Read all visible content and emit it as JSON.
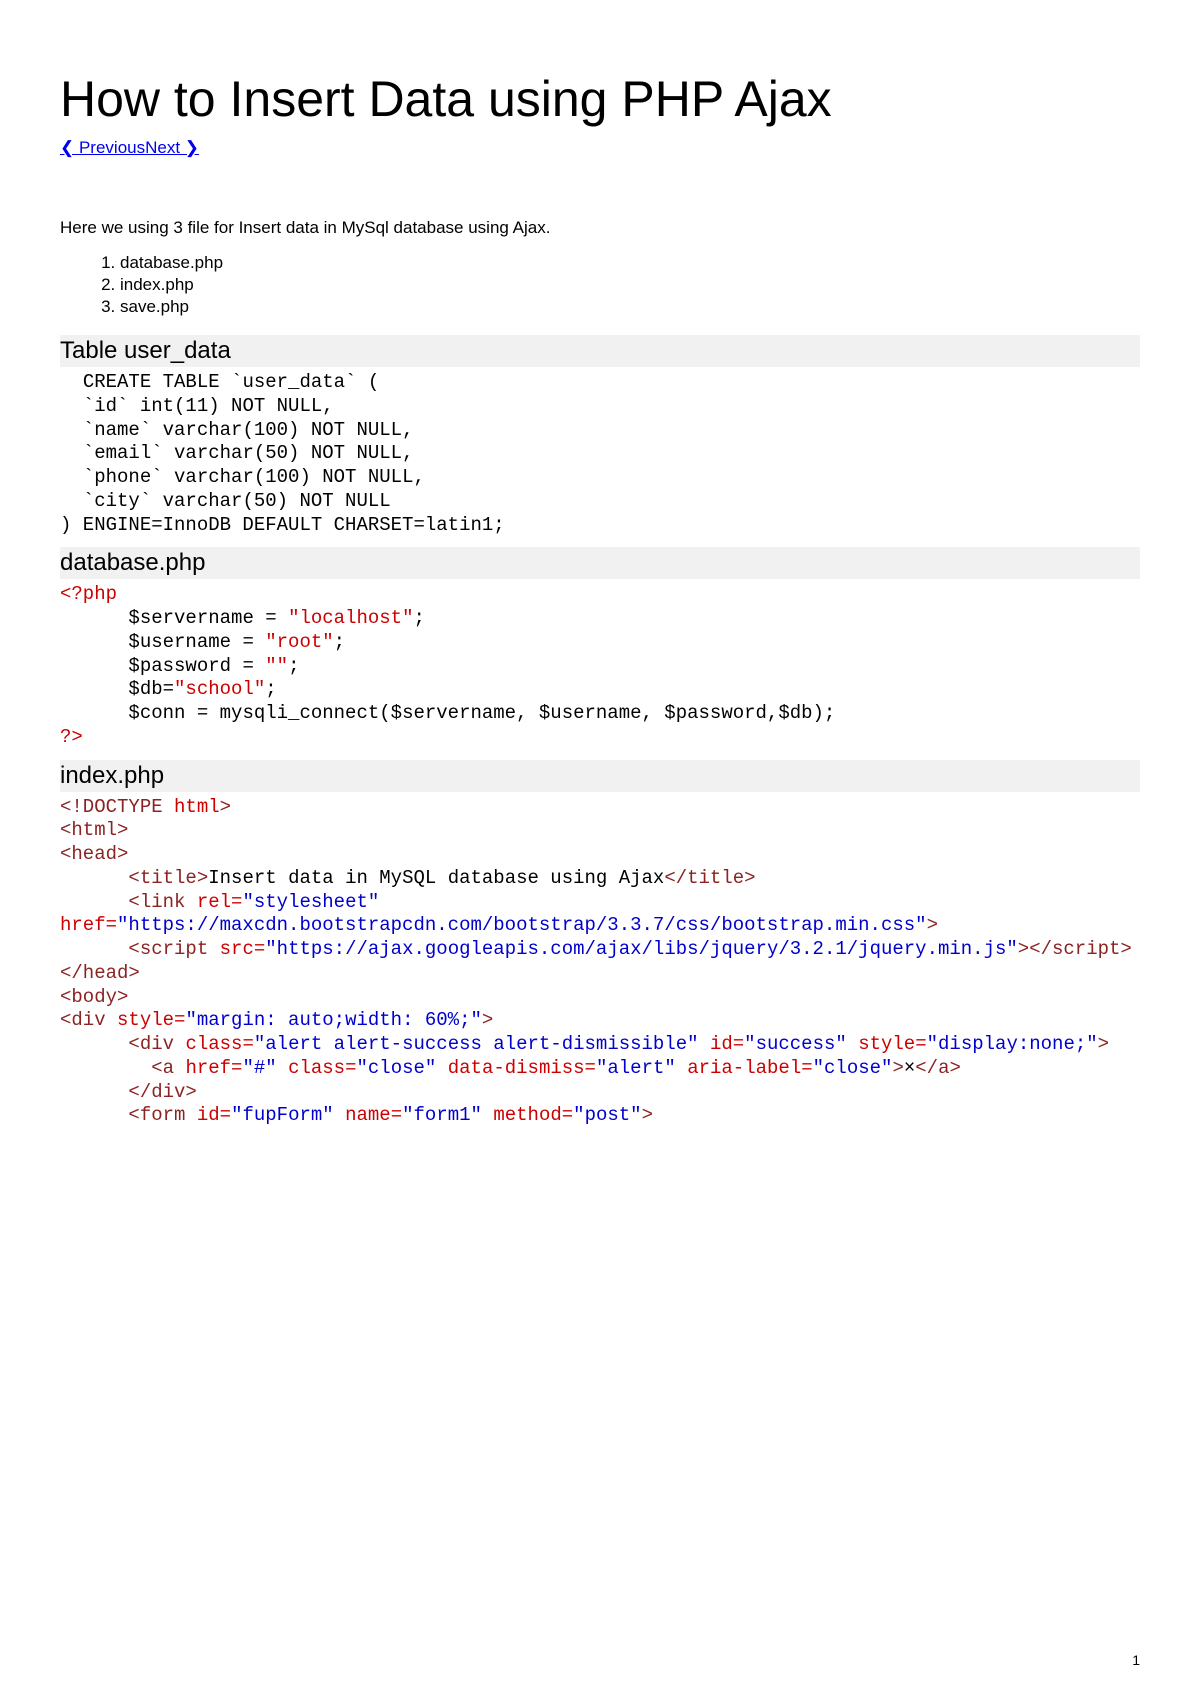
{
  "title": "How to Insert Data using PHP Ajax",
  "nav": {
    "previous": "❮ Previous",
    "next": "Next ❯"
  },
  "intro": "Here we using 3 file for Insert data in MySql database using Ajax.",
  "files": [
    "database.php",
    "index.php",
    "save.php"
  ],
  "sections": {
    "s1": {
      "heading": "Table user_data",
      "code": "  CREATE TABLE `user_data` (\n  `id` int(11) NOT NULL,\n  `name` varchar(100) NOT NULL,\n  `email` varchar(50) NOT NULL,\n  `phone` varchar(100) NOT NULL,\n  `city` varchar(50) NOT NULL\n) ENGINE=InnoDB DEFAULT CHARSET=latin1;"
    },
    "s2": {
      "heading": "database.php",
      "code_html": "<span class=\"red\">&lt;?php</span>\n      $servername = <span class=\"red\">\"localhost\"</span>;\n      $username = <span class=\"red\">\"root\"</span>;\n      $password = <span class=\"red\">\"\"</span>;\n      $db=<span class=\"red\">\"school\"</span>;\n      $conn = mysqli_connect($servername, $username, $password,$db);\n<span class=\"red\">?&gt;</span>"
    },
    "s3": {
      "heading": "index.php",
      "code_html": "<span class=\"brown\">&lt;!DOCTYPE</span> <span class=\"red\">html</span><span class=\"brown\">&gt;</span>\n<span class=\"brown\">&lt;html&gt;</span>\n<span class=\"brown\">&lt;head&gt;</span>\n      <span class=\"brown\">&lt;title&gt;</span>Insert data in MySQL database using Ajax<span class=\"brown\">&lt;/title&gt;</span>\n      <span class=\"brown\">&lt;link</span> <span class=\"red\">rel=</span><span class=\"blue\">\"stylesheet\"</span> <span class=\"red\">href=</span><span class=\"blue\">\"https://maxcdn.bootstrapcdn.com/bootstrap/3.3.7/css/bootstrap.min.css\"</span><span class=\"brown\">&gt;</span>\n      <span class=\"brown\">&lt;script</span> <span class=\"red\">src=</span><span class=\"blue\">\"https://ajax.googleapis.com/ajax/libs/jquery/3.2.1/jquery.min.js\"</span><span class=\"brown\">&gt;&lt;/script&gt;</span>\n<span class=\"brown\">&lt;/head&gt;</span>\n<span class=\"brown\">&lt;body&gt;</span>\n<span class=\"brown\">&lt;div</span> <span class=\"red\">style=</span><span class=\"blue\">\"margin: auto;width: 60%;\"</span><span class=\"brown\">&gt;</span>\n      <span class=\"brown\">&lt;div</span> <span class=\"red\">class=</span><span class=\"blue\">\"alert alert-success alert-dismissible\"</span> <span class=\"red\">id=</span><span class=\"blue\">\"success\"</span> <span class=\"red\">style=</span><span class=\"blue\">\"display:none;\"</span><span class=\"brown\">&gt;</span>\n        <span class=\"brown\">&lt;a</span> <span class=\"red\">href=</span><span class=\"blue\">\"#\"</span> <span class=\"red\">class=</span><span class=\"blue\">\"close\"</span> <span class=\"red\">data-dismiss=</span><span class=\"blue\">\"alert\"</span> <span class=\"red\">aria-label=</span><span class=\"blue\">\"close\"</span><span class=\"brown\">&gt;</span>×<span class=\"brown\">&lt;/a&gt;</span>\n      <span class=\"brown\">&lt;/div&gt;</span>\n      <span class=\"brown\">&lt;form</span> <span class=\"red\">id=</span><span class=\"blue\">\"fupForm\"</span> <span class=\"red\">name=</span><span class=\"blue\">\"form1\"</span> <span class=\"red\">method=</span><span class=\"blue\">\"post\"</span><span class=\"brown\">&gt;</span>"
    }
  },
  "page_number": "1"
}
